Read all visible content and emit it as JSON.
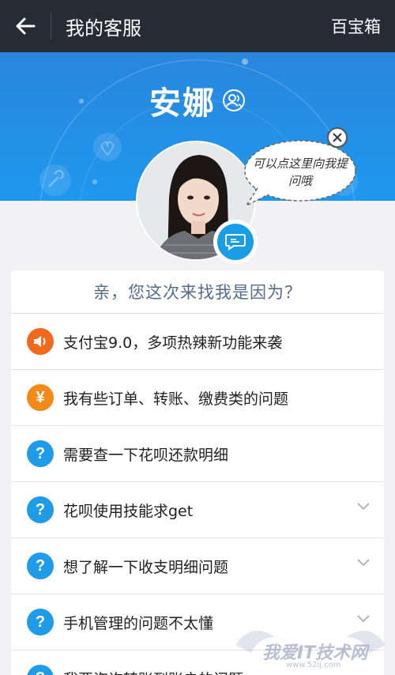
{
  "topbar": {
    "title": "我的客服",
    "right_label": "百宝箱"
  },
  "agent": {
    "name": "安娜"
  },
  "bubble": {
    "text": "可以点这里向我提问哦"
  },
  "prompt": "亲，您这次来找我是因为？",
  "questions": [
    {
      "label": "支付宝9.0，多项热辣新功能来袭",
      "icon": "speaker-icon",
      "color": "#f06a1d",
      "expandable": false
    },
    {
      "label": "我有些订单、转账、缴费类的问题",
      "icon": "yen-icon",
      "color": "#f28a1a",
      "expandable": false
    },
    {
      "label": "需要查一下花呗还款明细",
      "icon": "question-icon",
      "color": "#1f9be8",
      "expandable": false
    },
    {
      "label": "花呗使用技能求get",
      "icon": "question-icon",
      "color": "#1f9be8",
      "expandable": true
    },
    {
      "label": "想了解一下收支明细问题",
      "icon": "question-icon",
      "color": "#1f9be8",
      "expandable": true
    },
    {
      "label": "手机管理的问题不太懂",
      "icon": "question-icon",
      "color": "#1f9be8",
      "expandable": true
    },
    {
      "label": "我要咨询转账到账户的问题",
      "icon": "question-icon",
      "color": "#1f9be8",
      "expandable": false
    }
  ],
  "icon_glyphs": {
    "yen": "¥",
    "question": "?"
  },
  "watermark": {
    "text": "我爱IT技术网",
    "sub": "www.52ij.com"
  }
}
